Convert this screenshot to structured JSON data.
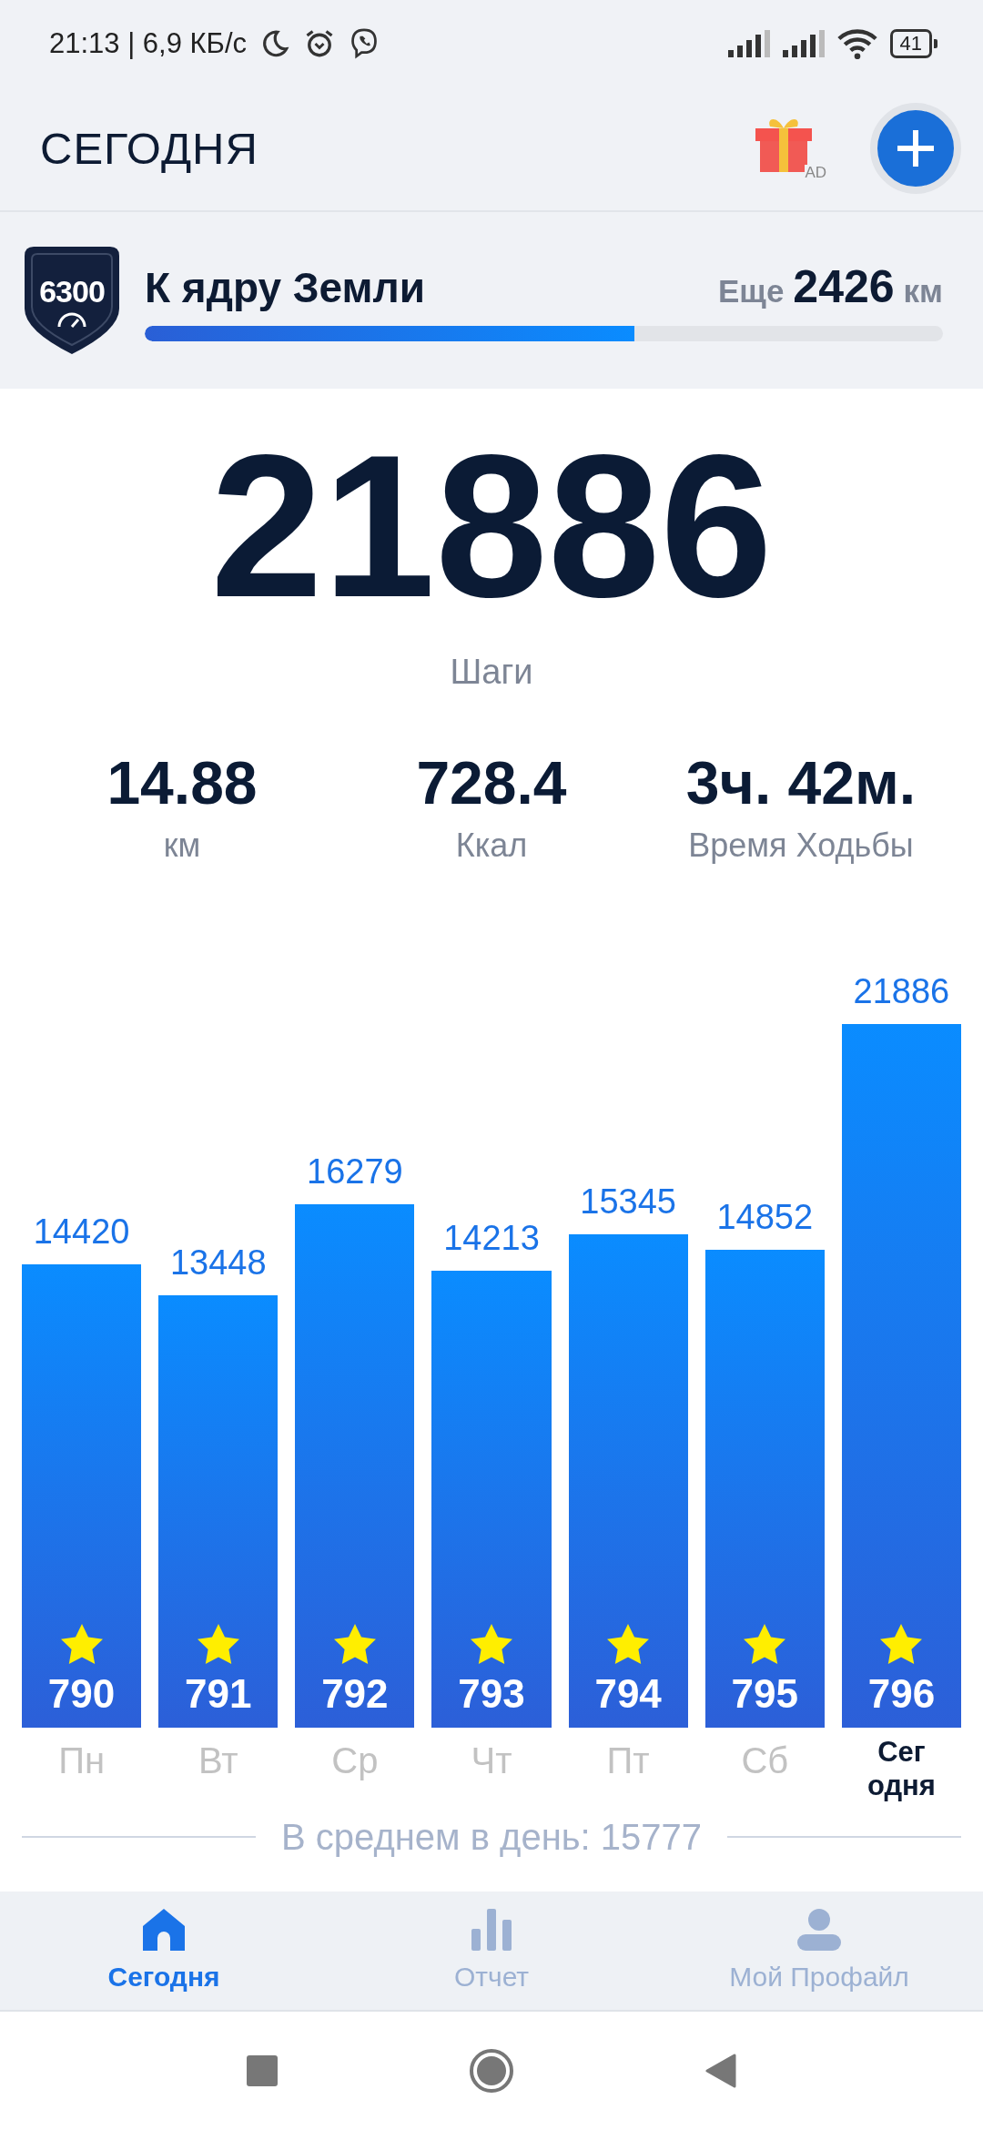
{
  "status_bar": {
    "time": "21:13 | 6,9 КБ/с",
    "battery": "41"
  },
  "header": {
    "title": "СЕГОДНЯ",
    "gift_badge": "AD"
  },
  "goal": {
    "badge": "6300",
    "title": "К ядру Земли",
    "remaining_prefix": "Еще",
    "remaining_value": "2426",
    "remaining_unit": "км",
    "level": 0.614
  },
  "summary": {
    "steps": "21886",
    "steps_label": "Шаги",
    "stats": [
      {
        "value": "14.88",
        "label": "км"
      },
      {
        "value": "728.4",
        "label": "Ккал"
      },
      {
        "value": "3ч. 42м.",
        "label": "Время Ходьбы"
      }
    ]
  },
  "chart": {
    "chart_data": {
      "type": "bar",
      "categories": [
        "Пн",
        "Вт",
        "Ср",
        "Чт",
        "Пт",
        "Сб",
        "Сег\nодня"
      ],
      "values": [
        14420,
        13448,
        16279,
        14213,
        15345,
        14852,
        21886
      ],
      "data_labels": true
    },
    "days": [
      {
        "selected": false
      },
      {
        "selected": false
      },
      {
        "selected": false
      },
      {
        "selected": false
      },
      {
        "selected": false
      },
      {
        "selected": false
      },
      {
        "selected": true
      }
    ],
    "bar_badges": [
      "790",
      "791",
      "792",
      "793",
      "794",
      "795",
      "796"
    ],
    "average": "В среднем в день: 15777"
  },
  "bottom_nav": [
    {
      "label": "Сегодня",
      "selected": true
    },
    {
      "label": "Отчет",
      "selected": false
    },
    {
      "label": "Мой Профайл",
      "selected": false
    }
  ]
}
